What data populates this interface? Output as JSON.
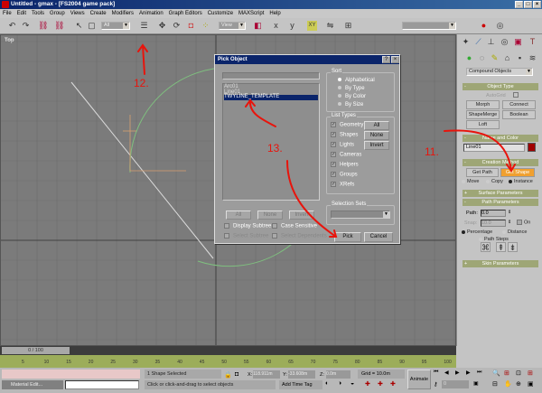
{
  "window": {
    "title": "Untitled - gmax - [FS2004 game pack]",
    "help_btn": "?",
    "close_btn": "×",
    "min_btn": "_",
    "max_btn": "□"
  },
  "menu": [
    "File",
    "Edit",
    "Tools",
    "Group",
    "Views",
    "Create",
    "Modifiers",
    "Animation",
    "Graph Editors",
    "Customize",
    "MAXScript",
    "Help"
  ],
  "toolbar": {
    "selection_filter": "All",
    "ref_coord": "View"
  },
  "viewport": {
    "label": "Top"
  },
  "annotations": {
    "a12": "12.",
    "a13": "13.",
    "a11": "11.",
    "color": "#e8140c"
  },
  "dialog": {
    "title": "Pick Object",
    "help": "?",
    "close": "×",
    "filter_value": "",
    "objects": [
      {
        "name": "Arc01",
        "selected": false
      },
      {
        "name": "Line01",
        "selected": false
      },
      {
        "name": "TWYLINE_TEMPLATE",
        "selected": true
      }
    ],
    "sort_label": "Sort",
    "sort_options": [
      "Alphabetical",
      "By Type",
      "By Color",
      "By Size"
    ],
    "sort_selected": "Alphabetical",
    "list_types_label": "List Types",
    "list_types": [
      "Geometry",
      "Shapes",
      "Lights",
      "Cameras",
      "Helpers",
      "Groups",
      "XRefs"
    ],
    "type_buttons": [
      "All",
      "None",
      "Invert"
    ],
    "list_buttons": [
      "All",
      "None",
      "Invert"
    ],
    "selection_sets_label": "Selection Sets",
    "display_subtree": "Display Subtree",
    "case_sensitive": "Case Sensitive",
    "select_subtree": "Select Subtree",
    "select_dependents": "Select Dependents",
    "pick": "Pick",
    "cancel": "Cancel"
  },
  "cmdpanel": {
    "category": "Compound Objects",
    "object_type": "Object Type",
    "autogrid": "AutoGrid",
    "buttons": [
      "Morph",
      "Connect",
      "ShapeMerge",
      "Boolean",
      "Loft"
    ],
    "name_and_color": "Name and Color",
    "name": "Line01",
    "color": "#a00000",
    "creation_method": "Creation Method",
    "get_path": "Get Path",
    "get_shape": "Get Shape",
    "creation_options": [
      "Move",
      "Copy",
      "Instance"
    ],
    "creation_selected": "Instance",
    "surface_parameters": "Surface Parameters",
    "path_parameters": "Path Parameters",
    "path_label": "Path:",
    "path_value": "0.0",
    "snap_label": "Snap:",
    "snap_value": "10.0",
    "on_label": "On",
    "path_modes": [
      "Percentage",
      "Distance"
    ],
    "path_steps": "Path Steps",
    "path_mode_selected": "Percentage",
    "skin_parameters": "Skin Parameters"
  },
  "timeline": {
    "position": "0 / 100",
    "ticks": [
      "5",
      "10",
      "15",
      "20",
      "25",
      "30",
      "35",
      "40",
      "45",
      "50",
      "55",
      "60",
      "65",
      "70",
      "75",
      "80",
      "85",
      "90",
      "95",
      "100"
    ]
  },
  "status": {
    "selected": "1 Shape Selected",
    "prompt": "Click or click-and-drag to select objects",
    "x_label": "X:",
    "x": "118.911m",
    "y_label": "Y:",
    "y": "-33.608m",
    "z_label": "Z:",
    "z": "0.0m",
    "grid": "Grid = 10.0m",
    "add_time_tag": "Add Time Tag",
    "animate": "Animate",
    "frame": "0",
    "taskbar": "Material Edit..."
  }
}
